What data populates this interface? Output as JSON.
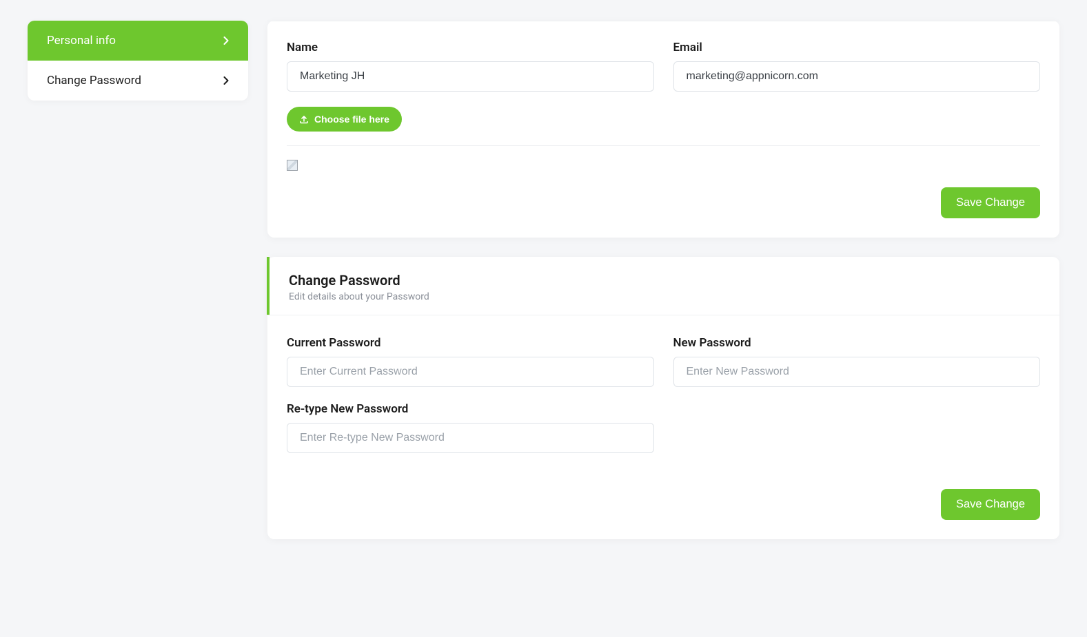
{
  "sidebar": {
    "items": [
      {
        "label": "Personal info"
      },
      {
        "label": "Change Password"
      }
    ]
  },
  "personal": {
    "name_label": "Name",
    "name_value": "Marketing JH",
    "email_label": "Email",
    "email_value": "marketing@appnicorn.com",
    "choose_file_label": "Choose file here",
    "save_label": "Save Change"
  },
  "password": {
    "title": "Change Password",
    "subtitle": "Edit details about your Password",
    "current_label": "Current Password",
    "current_placeholder": "Enter Current Password",
    "new_label": "New Password",
    "new_placeholder": "Enter New Password",
    "retype_label": "Re-type New Password",
    "retype_placeholder": "Enter Re-type New Password",
    "save_label": "Save Change"
  },
  "colors": {
    "accent": "#6ec72e"
  }
}
